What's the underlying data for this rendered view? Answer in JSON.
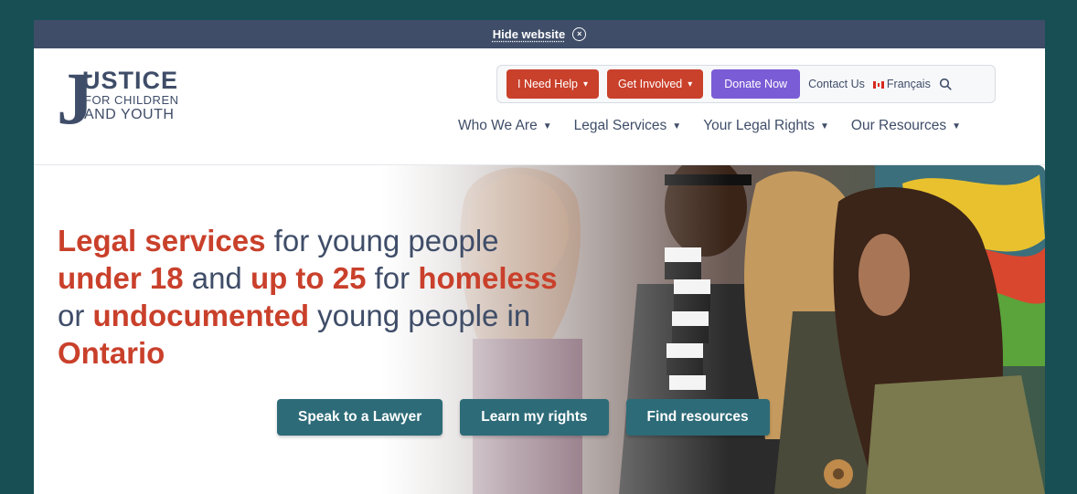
{
  "notice": {
    "hide_label": "Hide website",
    "close_glyph": "×"
  },
  "logo": {
    "letter": "J",
    "line1": "USTICE",
    "line2": "FOR CHILDREN",
    "line3": "AND YOUTH"
  },
  "utility": {
    "need_help": "I Need Help",
    "get_involved": "Get Involved",
    "donate": "Donate Now",
    "contact": "Contact Us",
    "language": "Français"
  },
  "nav": {
    "items": [
      {
        "label": "Who We Are"
      },
      {
        "label": "Legal Services"
      },
      {
        "label": "Your Legal Rights"
      },
      {
        "label": "Our Resources"
      }
    ],
    "chevron": "⌄"
  },
  "hero": {
    "headline": {
      "p1": "Legal services",
      "p2": " for young people ",
      "p3": "under 18",
      "p4": " and ",
      "p5": "up to 25",
      "p6": " for ",
      "p7": "homeless",
      "p8": " or ",
      "p9": "undocumented",
      "p10": " young people in ",
      "p11": "Ontario"
    },
    "ctas": [
      "Speak to a Lawyer",
      "Learn my rights",
      "Find resources"
    ]
  },
  "colors": {
    "frame": "#174f55",
    "notice_bar": "#3f4d68",
    "brand_navy": "#3f4d68",
    "accent_red": "#c9402b",
    "donate_purple": "#7a5cd6",
    "cta_teal": "#2d6b78"
  },
  "icons": {
    "close": "close-circle-icon",
    "search": "search-icon",
    "flag": "canada-flag-icon",
    "chevron": "chevron-down-icon"
  }
}
